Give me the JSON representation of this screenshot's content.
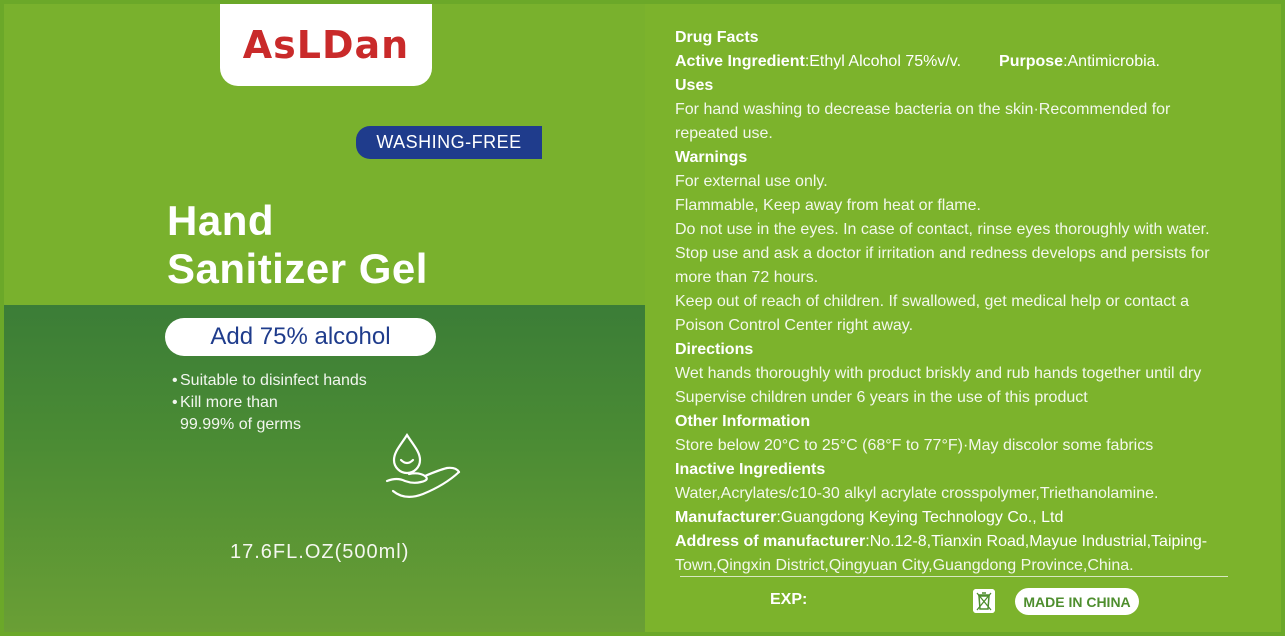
{
  "brand": {
    "name": "AsLDan"
  },
  "badge": {
    "text": "WASHING-FREE"
  },
  "product": {
    "title_line1": "Hand",
    "title_line2": "Sanitizer Gel",
    "alcohol": "Add 75% alcohol",
    "bullets": [
      "Suitable to disinfect hands",
      "Kill more than",
      "99.99% of germs"
    ],
    "volume": "17.6FL.OZ(500ml)"
  },
  "facts": {
    "title": "Drug Facts",
    "active_label": "Active Ingredient",
    "active_value": ":Ethyl Alcohol 75%v/v.",
    "purpose_label": "Purpose",
    "purpose_value": ":Antimicrobia.",
    "uses_title": "Uses",
    "uses_lines": [
      "For hand washing to decrease bacteria on the skin·Recommended for",
      "repeated use."
    ],
    "warnings_title": "Warnings",
    "warnings_lines": [
      "For external use only.",
      "Flammable, Keep away from heat or flame.",
      "Do not use in the eyes. In case of contact, rinse eyes thoroughly with water.",
      "Stop use and ask a doctor if irritation and redness develops and persists for",
      "more than 72 hours.",
      "Keep out of reach of children. If swallowed, get medical help or contact a",
      "Poison Control Center right away."
    ],
    "directions_title": "Directions",
    "directions_lines": [
      "Wet hands thoroughly with product briskly and rub hands together until dry",
      "Supervise children under 6 years in the use of this product"
    ],
    "other_title": "Other Information",
    "other_line": "Store below 20°C to 25°C (68°F to 77°F)·May discolor some fabrics",
    "inactive_title": "Inactive Ingredients",
    "inactive_line": "Water,Acrylates/c10-30 alkyl acrylate crosspolymer,Triethanolamine.",
    "manufacturer_label": "Manufacturer",
    "manufacturer_value": ":Guangdong Keying Technology Co., Ltd",
    "address_label": "Address of manufacturer",
    "address_value": ":No.12-8,Tianxin Road,Mayue Industrial,Taiping-",
    "address_line2": "Town,Qingxin District,Qingyuan City,Guangdong Province,China."
  },
  "footer": {
    "exp": "EXP:",
    "made_in": "MADE IN CHINA",
    "recycle_icon": "trash-bin-icon"
  },
  "colors": {
    "green": "#79b12d",
    "dark_green": "#3b7d37",
    "logo_red": "#c92a2a",
    "navy": "#1f3c8c"
  }
}
